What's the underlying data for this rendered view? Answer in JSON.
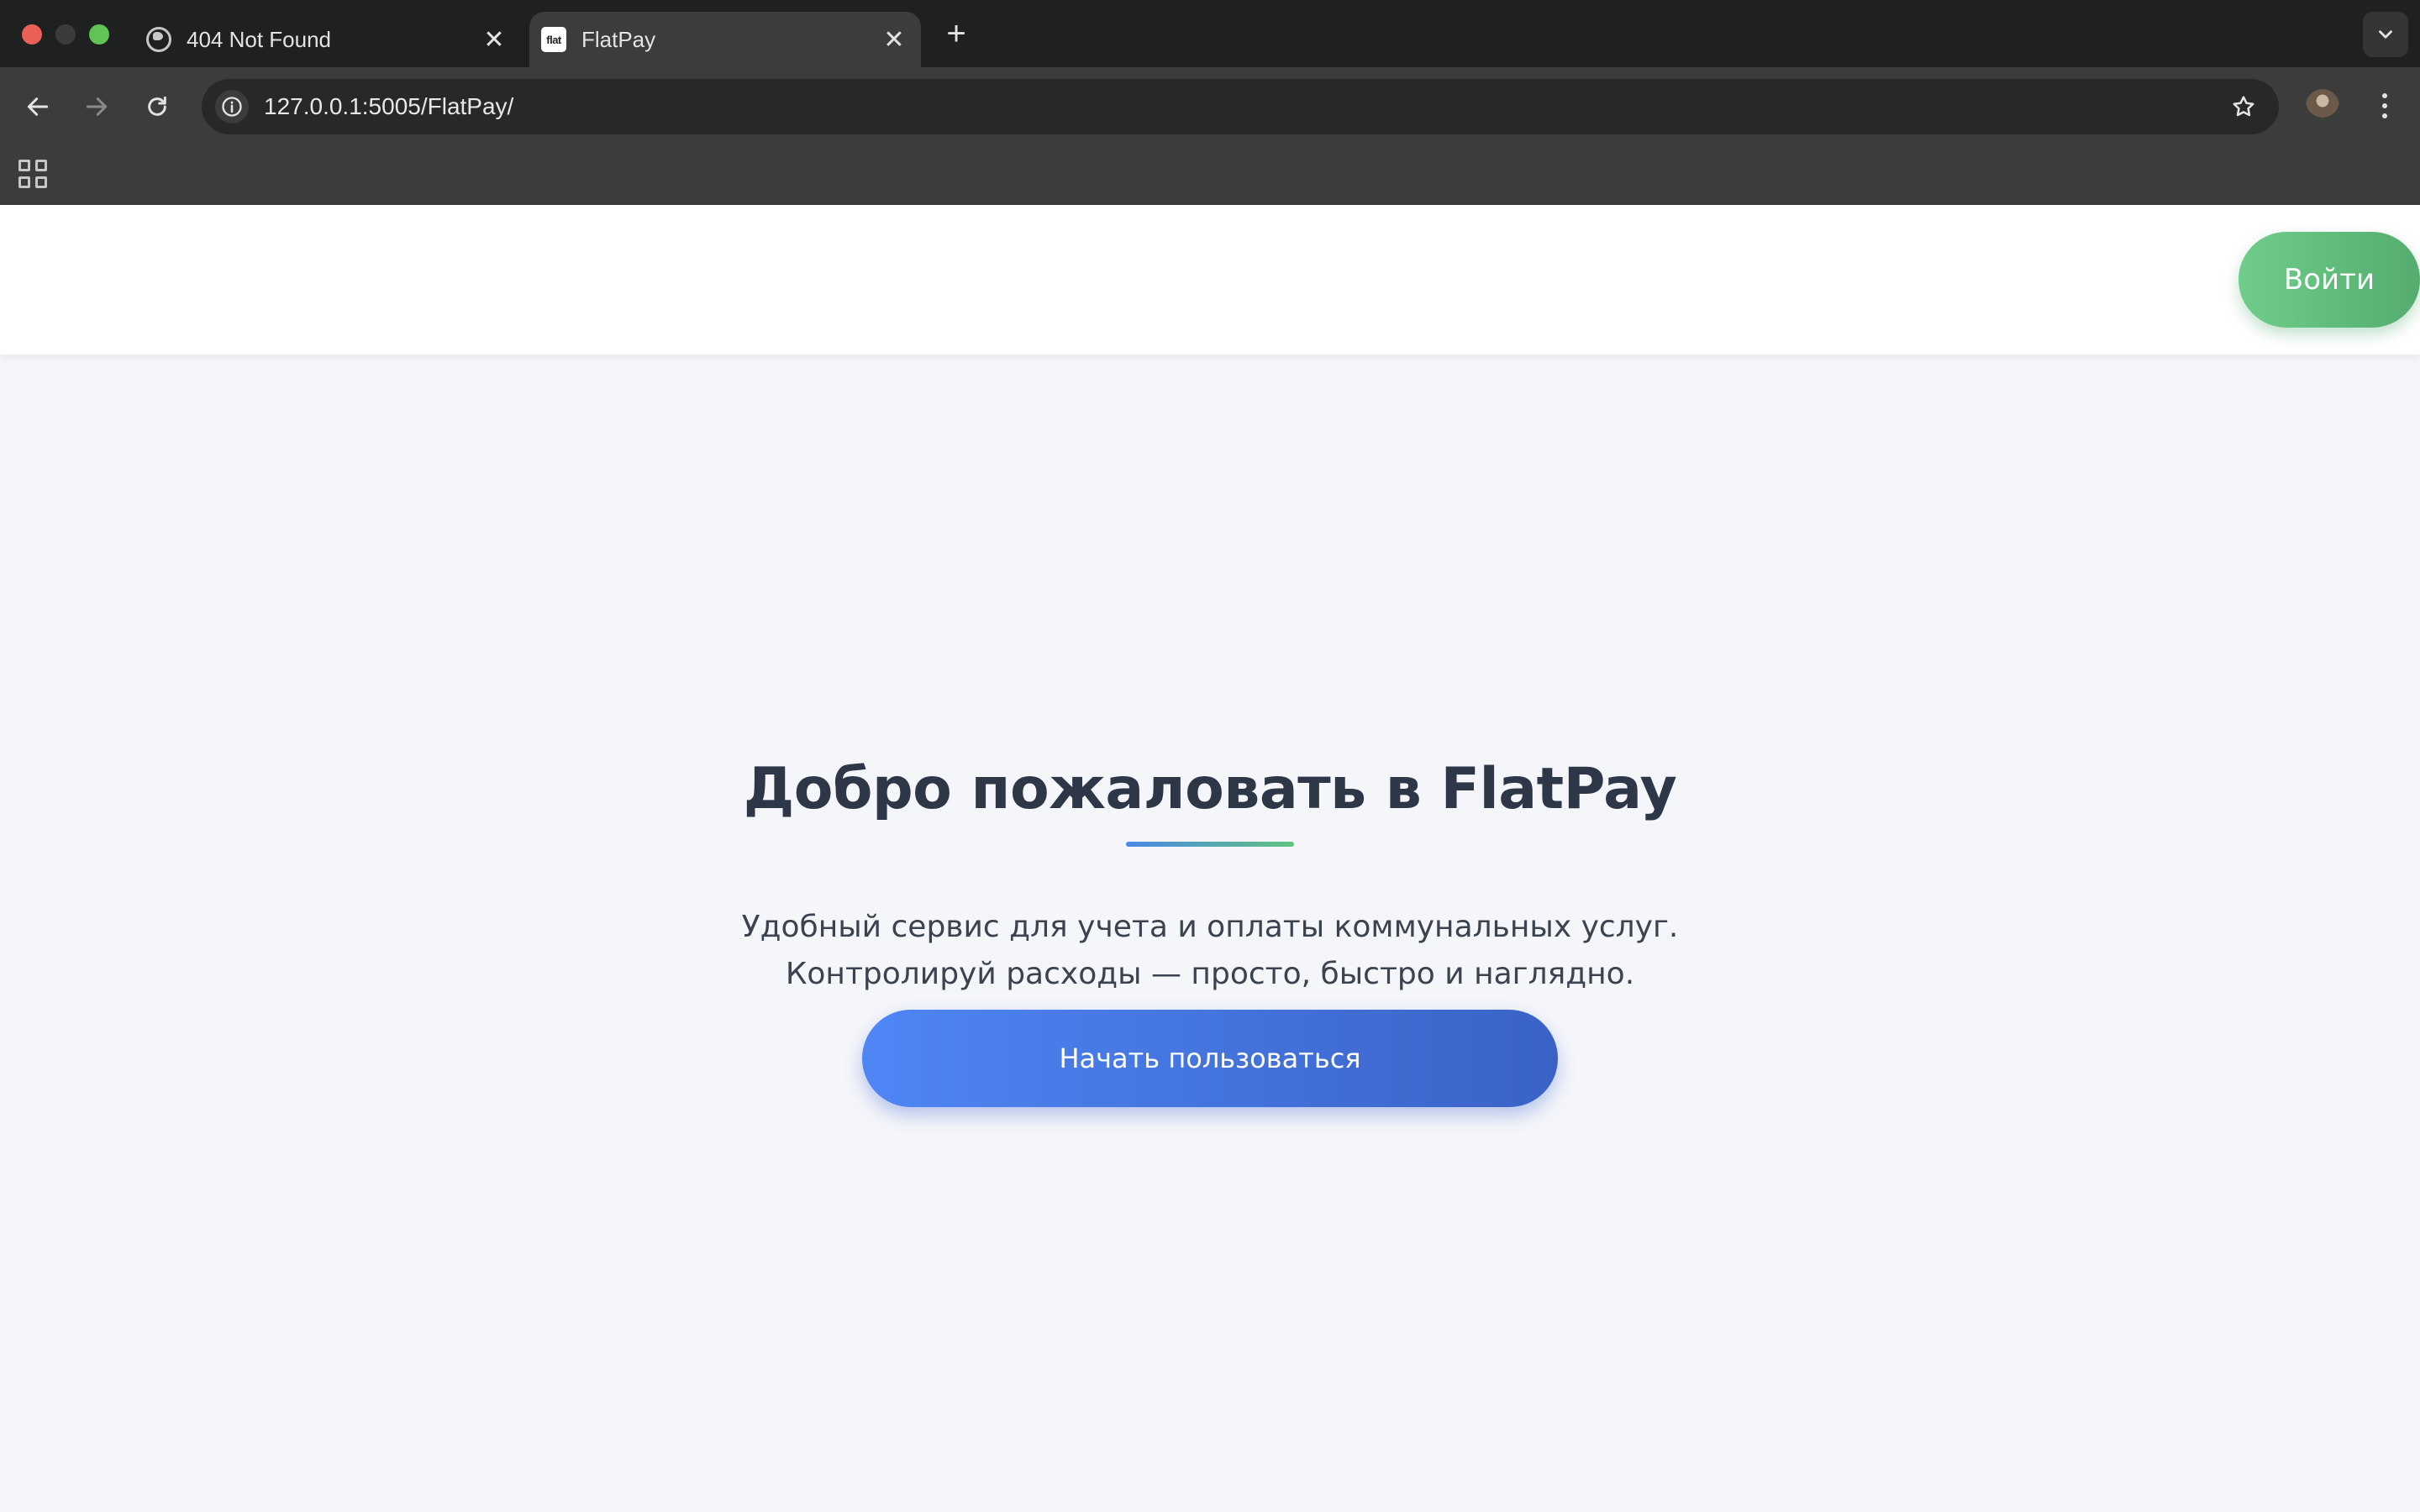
{
  "browser": {
    "tabs": [
      {
        "title": "404 Not Found",
        "icon": "globe-icon",
        "active": false
      },
      {
        "title": "FlatPay",
        "icon": "flat-favicon",
        "favicon_text": "flat",
        "active": true
      }
    ],
    "close_glyph": "✕",
    "new_tab_glyph": "+",
    "url": "127.0.0.1:5005/FlatPay/"
  },
  "site": {
    "header": {
      "login_label": "Войти"
    },
    "hero": {
      "title": "Добро пожаловать в FlatPay",
      "text_line1": "Удобный сервис для учета и оплаты коммунальных услуг.",
      "text_line2": "Контролируй расходы — просто, быстро и наглядно.",
      "cta_label": "Начать пользоваться"
    }
  },
  "colors": {
    "login_gradient": [
      "#6fcd8a",
      "#54ad6f"
    ],
    "cta_gradient": [
      "#4f86f5",
      "#3a62c6"
    ],
    "title": "#2d3748",
    "background": "#f5f6fa"
  }
}
